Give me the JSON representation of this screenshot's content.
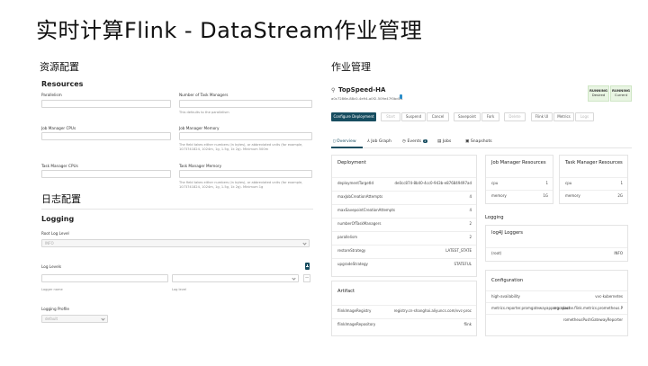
{
  "slide": {
    "title": "实时计算Flink - DataStream作业管理"
  },
  "left": {
    "section_resources": "资源配置",
    "resources_title": "Resources",
    "parallelism_label": "Parallelism",
    "task_managers_label": "Number of Task Managers",
    "task_managers_hint": "This defaults to the parallelism",
    "jm_cpus_label": "Job Manager CPUs",
    "jm_memory_label": "Job Manager Memory",
    "jm_memory_hint": "The field takes either numbers (in bytes), or abbreviated units (for example, 1073741824, 1024m, 1g, 1.5g, 1k 2g). Minimum 500m",
    "tm_cpus_label": "Task Manager CPUs",
    "tm_memory_label": "Task Manager Memory",
    "tm_memory_hint": "The field takes either numbers (in bytes), or abbreviated units (for example, 1073741824, 1024m, 1g, 1.5g, 1k 2g). Minimum 1g",
    "section_logging": "日志配置",
    "logging_title": "Logging",
    "root_log_level_label": "Root Log Level",
    "root_log_level_value": "INFO",
    "log_levels_label": "Log Levels",
    "logger_name_hint": "Logger name",
    "log_level_hint": "Log level",
    "add_icon": "plus-icon",
    "remove_icon": "minus-icon",
    "logging_profile_label": "Logging Profile",
    "logging_profile_value": "default"
  },
  "right": {
    "section_job": "作业管理",
    "job_name": "TopSpeed-HA",
    "job_id": "a0c7286e-88c0-4e94-a0f2-509e47f0bd04",
    "status_badges": [
      {
        "state": "RUNNING",
        "label": "Desired"
      },
      {
        "state": "RUNNING",
        "label": "Current"
      }
    ],
    "toolbar": {
      "configure": "Configure Deployment",
      "start": "Start",
      "suspend": "Suspend",
      "cancel": "Cancel",
      "savepoint": "Savepoint",
      "fork": "Fork",
      "delete": "Delete",
      "flink_ui": "Flink UI",
      "metrics": "Metrics",
      "logs": "Logs"
    },
    "tabs": [
      "Overview",
      "Job Graph",
      "Events",
      "Jobs",
      "Snapshots"
    ],
    "events_count": "1",
    "deployment": {
      "title": "Deployment",
      "rows": [
        {
          "k": "deploymentTargetId",
          "v": "de0cc874-8b40-4cc0-943b-e876849497ad"
        },
        {
          "k": "maxJobCreationAttempts",
          "v": "4"
        },
        {
          "k": "maxSavepointCreationAttempts",
          "v": "4"
        },
        {
          "k": "numberOfTaskManagers",
          "v": "2"
        },
        {
          "k": "parallelism",
          "v": "2"
        },
        {
          "k": "restoreStrategy",
          "v": "LATEST_STATE"
        },
        {
          "k": "upgradeStrategy",
          "v": "STATEFUL"
        }
      ]
    },
    "artifact": {
      "title": "Artifact",
      "rows": [
        {
          "k": "flinkImageRegistry",
          "v": "registry.cn-shanghai.aliyuncs.com/vvc-proc"
        },
        {
          "k": "flinkImageRepository",
          "v": "flink"
        }
      ]
    },
    "jm_resources": {
      "title": "Job Manager Resources",
      "rows": [
        {
          "k": "cpu",
          "v": "1"
        },
        {
          "k": "memory",
          "v": "1G"
        }
      ]
    },
    "tm_resources": {
      "title": "Task Manager Resources",
      "rows": [
        {
          "k": "cpu",
          "v": "1"
        },
        {
          "k": "memory",
          "v": "2G"
        }
      ]
    },
    "logging_header": "Logging",
    "log4j": {
      "title": "log4J Loggers",
      "rows": [
        {
          "k": "(root)",
          "v": "INFO"
        }
      ]
    },
    "configuration": {
      "title": "Configuration",
      "rows": [
        {
          "k": "high-availability",
          "v": "vvc-kubernetes"
        },
        {
          "k": "metrics.reporter.promgatewayappmgr.class",
          "v": "org.apache.flink.metrics.prometheus.P"
        },
        {
          "k": "",
          "v": "rometheusPushGatewayReporter"
        }
      ]
    }
  }
}
